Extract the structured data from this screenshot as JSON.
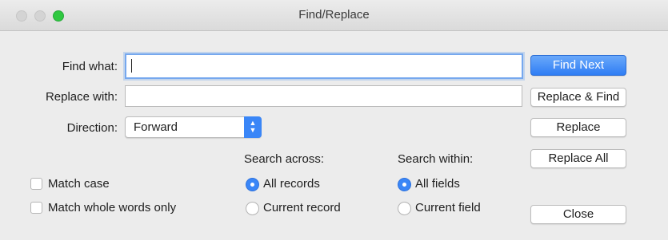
{
  "window": {
    "title": "Find/Replace"
  },
  "find": {
    "label": "Find what:",
    "value": ""
  },
  "replace": {
    "label": "Replace with:",
    "value": ""
  },
  "direction": {
    "label": "Direction:",
    "selected": "Forward"
  },
  "buttons": {
    "find_next": "Find Next",
    "replace_find": "Replace & Find",
    "replace": "Replace",
    "replace_all": "Replace All",
    "close": "Close"
  },
  "options": {
    "match_case": "Match case",
    "match_whole_words": "Match whole words only"
  },
  "search_across": {
    "heading": "Search across:",
    "all_records": "All records",
    "current_record": "Current record"
  },
  "search_within": {
    "heading": "Search within:",
    "all_fields": "All fields",
    "current_field": "Current field"
  },
  "colors": {
    "accent": "#3a86f7",
    "zoom_button": "#2fc840"
  },
  "icons": {
    "stepper": "updown-chevron-icon"
  }
}
